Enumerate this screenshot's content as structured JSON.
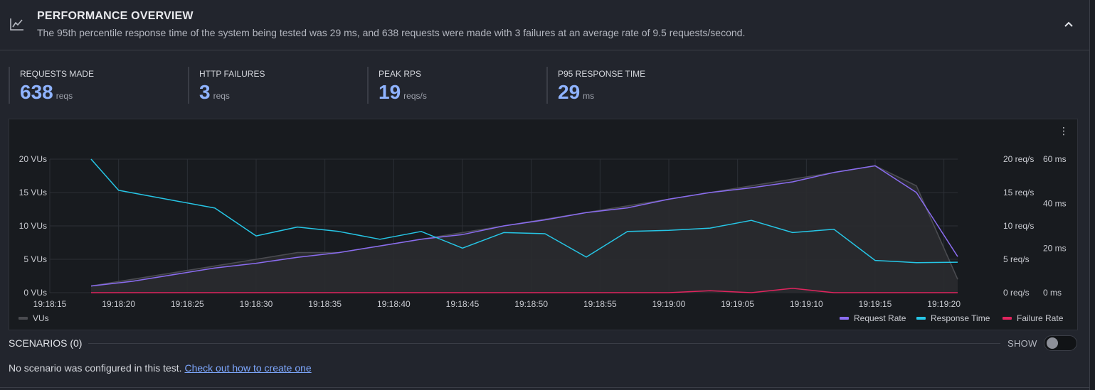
{
  "header": {
    "title": "PERFORMANCE OVERVIEW",
    "subtitle": "The 95th percentile response time of the system being tested was 29 ms, and 638 requests were made with 3 failures at an average rate of 9.5 requests/second."
  },
  "metrics": [
    {
      "label": "REQUESTS MADE",
      "value": "638",
      "unit": "reqs"
    },
    {
      "label": "HTTP FAILURES",
      "value": "3",
      "unit": "reqs"
    },
    {
      "label": "PEAK RPS",
      "value": "19",
      "unit": "reqs/s"
    },
    {
      "label": "P95 RESPONSE TIME",
      "value": "29",
      "unit": "ms"
    }
  ],
  "colors": {
    "vus": "#4a4b50",
    "request_rate": "#8a6cf0",
    "response_time": "#26c6e6",
    "failure_rate": "#e0245e",
    "metric_value": "#8fb3ff"
  },
  "chart_data": {
    "type": "line",
    "x_ticks": [
      "19:18:15",
      "19:18:20",
      "19:18:25",
      "19:18:30",
      "19:18:35",
      "19:18:40",
      "19:18:45",
      "19:18:50",
      "19:18:55",
      "19:19:00",
      "19:19:05",
      "19:19:10",
      "19:19:15",
      "19:19:20"
    ],
    "x_range": [
      "19:18:15",
      "19:19:21"
    ],
    "y_left": {
      "ticks": [
        "0 VUs",
        "5 VUs",
        "10 VUs",
        "15 VUs",
        "20 VUs"
      ],
      "range": [
        0,
        20
      ]
    },
    "y_right_rate": {
      "ticks": [
        "0 req/s",
        "5 req/s",
        "10 req/s",
        "15 req/s",
        "20 req/s"
      ],
      "range": [
        0,
        20
      ]
    },
    "y_right_time": {
      "ticks": [
        "0 ms",
        "20 ms",
        "40 ms",
        "60 ms"
      ],
      "range": [
        0,
        60
      ]
    },
    "x": [
      "19:18:18",
      "19:18:21",
      "19:18:27",
      "19:18:30",
      "19:18:33",
      "19:18:36",
      "19:18:39",
      "19:18:42",
      "19:18:45",
      "19:18:48",
      "19:18:51",
      "19:18:54",
      "19:18:57",
      "19:19:00",
      "19:19:03",
      "19:19:06",
      "19:19:09",
      "19:19:12",
      "19:19:15",
      "19:19:18",
      "19:19:21"
    ],
    "series": [
      {
        "name": "VUs",
        "axis": "vus",
        "values": [
          1,
          2,
          4,
          5,
          6,
          6,
          7,
          8,
          9,
          10,
          11,
          12,
          13,
          14,
          15,
          16,
          17,
          18,
          19,
          16,
          2
        ]
      },
      {
        "name": "Request Rate",
        "axis": "rate",
        "values": [
          1,
          1.7,
          3.7,
          4.4,
          5.3,
          6,
          7,
          8,
          8.7,
          10,
          10.9,
          12,
          12.7,
          14,
          15,
          15.7,
          16.6,
          18,
          19,
          15,
          5.4
        ]
      },
      {
        "name": "Response Time",
        "axis": "time",
        "values_x": [
          "19:18:18",
          "19:18:20",
          "19:18:27",
          "19:18:30",
          "19:18:33",
          "19:18:36",
          "19:18:39",
          "19:18:42",
          "19:18:45",
          "19:18:48",
          "19:18:51",
          "19:18:54",
          "19:18:57",
          "19:19:00",
          "19:19:03",
          "19:19:06",
          "19:19:09",
          "19:19:12",
          "19:19:15",
          "19:19:18",
          "19:19:21"
        ],
        "values": [
          60,
          46,
          38,
          25.5,
          29.5,
          27.5,
          24,
          27.5,
          20,
          27,
          26.5,
          16,
          27.5,
          28,
          29,
          32.5,
          27,
          28.5,
          14.5,
          13.5,
          13.7
        ]
      },
      {
        "name": "Failure Rate",
        "axis": "rate",
        "values": [
          0,
          0,
          0,
          0,
          0,
          0,
          0,
          0,
          0,
          0,
          0,
          0,
          0,
          0,
          0.3,
          0,
          0.65,
          0,
          0,
          0,
          0
        ]
      }
    ],
    "legend": {
      "left": [
        "VUs"
      ],
      "right": [
        "Request Rate",
        "Response Time",
        "Failure Rate"
      ]
    },
    "grid": true
  },
  "scenarios": {
    "title": "SCENARIOS (0)",
    "toggle_label": "SHOW",
    "note": "No scenario was configured in this test.",
    "link": "Check out how to create one"
  }
}
